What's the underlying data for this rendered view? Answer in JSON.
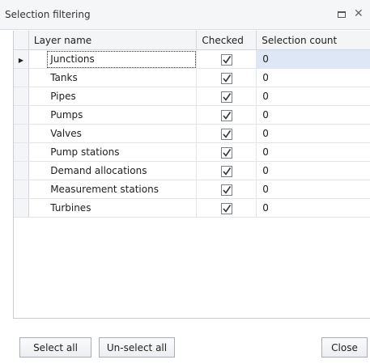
{
  "window": {
    "title": "Selection filtering"
  },
  "icons": {
    "maximize": "maximize-icon",
    "close": "close-icon",
    "checkbox": "checkbox-checked-icon",
    "row_indicator": "row-indicator-icon"
  },
  "grid": {
    "columns": [
      "Layer name",
      "Checked",
      "Selection count"
    ],
    "rows": [
      {
        "name": "Junctions",
        "checked": true,
        "count": "0",
        "current": true
      },
      {
        "name": "Tanks",
        "checked": true,
        "count": "0"
      },
      {
        "name": "Pipes",
        "checked": true,
        "count": "0"
      },
      {
        "name": "Pumps",
        "checked": true,
        "count": "0"
      },
      {
        "name": "Valves",
        "checked": true,
        "count": "0"
      },
      {
        "name": "Pump stations",
        "checked": true,
        "count": "0"
      },
      {
        "name": "Demand allocations",
        "checked": true,
        "count": "0"
      },
      {
        "name": "Measurement stations",
        "checked": true,
        "count": "0"
      },
      {
        "name": "Turbines",
        "checked": true,
        "count": "0"
      }
    ]
  },
  "buttons": {
    "select_all": "Select all",
    "unselect_all": "Un-select all",
    "close": "Close"
  },
  "colors": {
    "selected_row": "#dde7f6",
    "header_bg": "#f4f5f7",
    "titlebar_bg": "#f5f6f8"
  }
}
